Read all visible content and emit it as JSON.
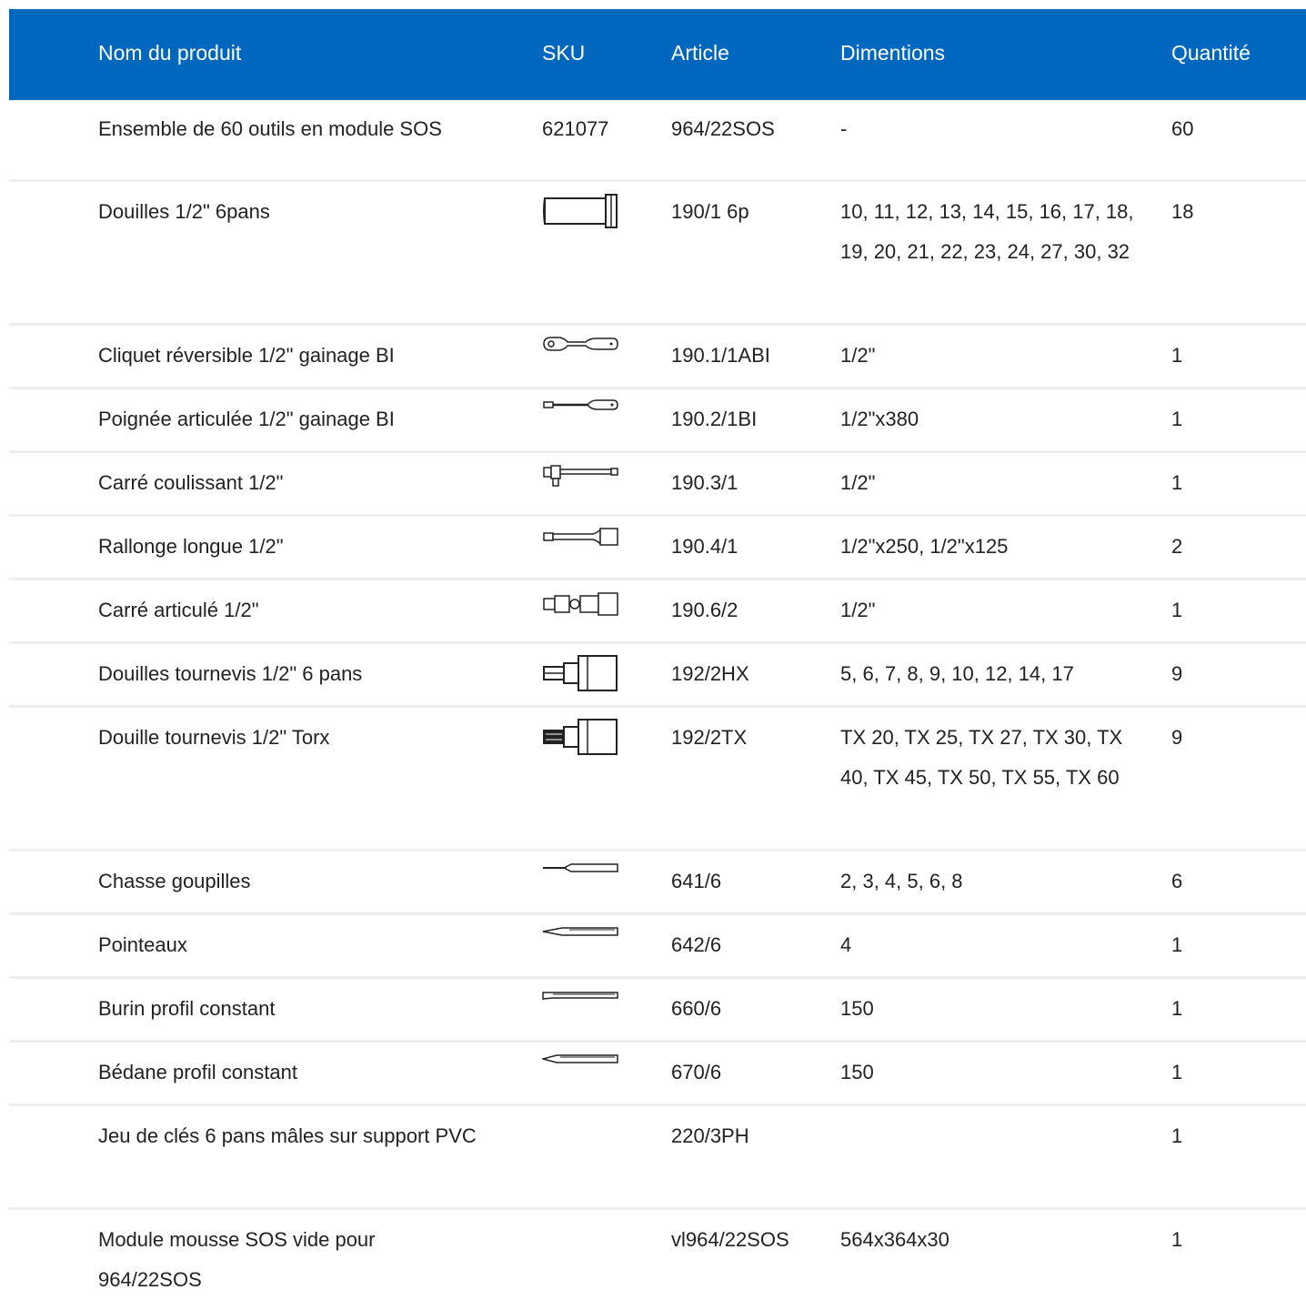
{
  "header": {
    "name": "Nom du produit",
    "sku": "SKU",
    "article": "Article",
    "dimensions": "Dimentions",
    "quantity": "Quantité"
  },
  "colors": {
    "header_bg": "#0067bf",
    "header_text": "#ffffff",
    "row_divider": "#eeeeee",
    "text": "#222222"
  },
  "rows": [
    {
      "name": "Ensemble de 60 outils en module SOS",
      "sku": "621077",
      "icon": "",
      "article": "964/22SOS",
      "dim": "-",
      "qty": "60"
    },
    {
      "name": "Douilles 1/2\" 6pans",
      "sku": "",
      "icon": "socket-icon",
      "article": "190/1 6p",
      "dim": "10, 11, 12, 13, 14, 15, 16, 17, 18, 19, 20, 21, 22, 23, 24, 27, 30, 32",
      "qty": "18"
    },
    {
      "name": "Cliquet réversible 1/2\" gainage BI",
      "sku": "",
      "icon": "ratchet-icon",
      "article": "190.1/1ABI",
      "dim": "1/2\"",
      "qty": "1"
    },
    {
      "name": "Poignée articulée 1/2\" gainage BI",
      "sku": "",
      "icon": "breaker-bar-icon",
      "article": "190.2/1BI",
      "dim": "1/2\"x380",
      "qty": "1"
    },
    {
      "name": "Carré coulissant 1/2\"",
      "sku": "",
      "icon": "sliding-t-bar-icon",
      "article": "190.3/1",
      "dim": "1/2\"",
      "qty": "1"
    },
    {
      "name": "Rallonge longue 1/2\"",
      "sku": "",
      "icon": "extension-bar-icon",
      "article": "190.4/1",
      "dim": "1/2\"x250, 1/2\"x125",
      "qty": "2"
    },
    {
      "name": "Carré articulé 1/2\"",
      "sku": "",
      "icon": "universal-joint-icon",
      "article": "190.6/2",
      "dim": "1/2\"",
      "qty": "1"
    },
    {
      "name": "Douilles tournevis 1/2\" 6 pans",
      "sku": "",
      "icon": "hex-bit-socket-icon",
      "article": "192/2HX",
      "dim": "5, 6, 7, 8, 9, 10, 12, 14, 17",
      "qty": "9"
    },
    {
      "name": "Douille tournevis 1/2\" Torx",
      "sku": "",
      "icon": "torx-bit-socket-icon",
      "article": "192/2TX",
      "dim": "TX 20, TX 25, TX 27, TX 30, TX 40, TX 45, TX 50, TX 55, TX 60",
      "qty": "9"
    },
    {
      "name": "Chasse goupilles",
      "sku": "",
      "icon": "pin-punch-icon",
      "article": "641/6",
      "dim": "2, 3, 4, 5, 6, 8",
      "qty": "6"
    },
    {
      "name": "Pointeaux",
      "sku": "",
      "icon": "center-punch-icon",
      "article": "642/6",
      "dim": "4",
      "qty": "1"
    },
    {
      "name": "Burin profil constant",
      "sku": "",
      "icon": "flat-chisel-icon",
      "article": "660/6",
      "dim": "150",
      "qty": "1"
    },
    {
      "name": "Bédane profil constant",
      "sku": "",
      "icon": "cape-chisel-icon",
      "article": "670/6",
      "dim": "150",
      "qty": "1"
    },
    {
      "name": "Jeu de clés 6 pans mâles sur support PVC",
      "sku": "",
      "icon": "",
      "article": "220/3PH",
      "dim": "",
      "qty": "1"
    },
    {
      "name": "Module mousse SOS vide pour 964/22SOS",
      "sku": "",
      "icon": "",
      "article": "vl964/22SOS",
      "dim": "564x364x30",
      "qty": "1"
    }
  ]
}
